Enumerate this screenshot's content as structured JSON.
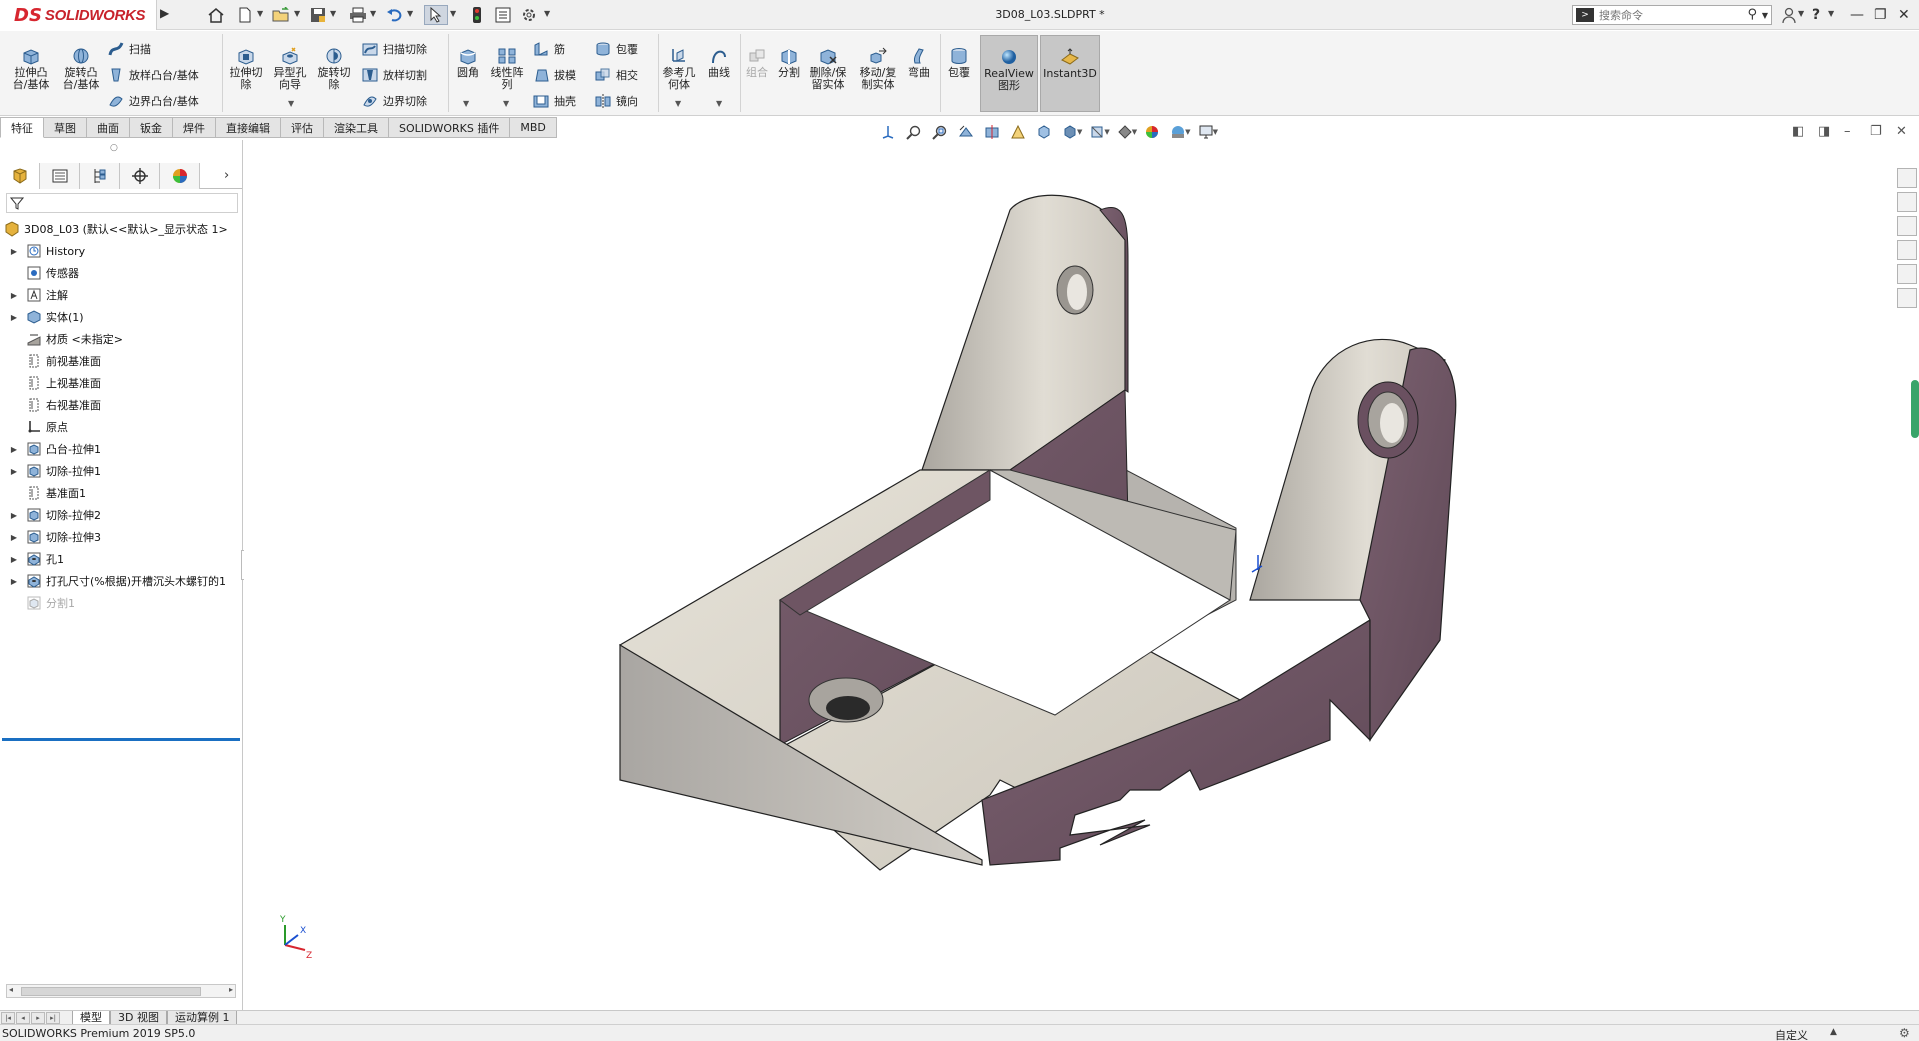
{
  "app": {
    "brand_ds": "DS",
    "brand_name": "SOLIDWORKS",
    "document_title": "3D08_L03.SLDPRT *",
    "search_placeholder": "搜索命令",
    "help": "?"
  },
  "ribbon": {
    "extrude_boss": "拉伸凸台/基体",
    "revolve_boss": "旋转凸台/基体",
    "sweep": "扫描",
    "loft_boss": "放样凸台/基体",
    "boundary_boss": "边界凸台/基体",
    "extrude_cut": "拉伸切除",
    "hole_wizard": "异型孔向导",
    "revolve_cut": "旋转切除",
    "sweep_cut": "扫描切除",
    "loft_cut": "放样切割",
    "boundary_cut": "边界切除",
    "fillet": "圆角",
    "linear_pattern": "线性阵列",
    "rib": "筋",
    "draft": "拔模",
    "shell": "抽壳",
    "wrap": "包覆",
    "intersect": "相交",
    "mirror": "镜向",
    "ref_geometry": "参考几何体",
    "curves": "曲线",
    "combine": "组合",
    "split": "分割",
    "delete_keep_body": "删除/保留实体",
    "move_copy_body": "移动/复制实体",
    "flex": "弯曲",
    "wrap2": "包覆",
    "realview": "RealView图形",
    "instant3d": "Instant3D"
  },
  "command_tabs": [
    "特征",
    "草图",
    "曲面",
    "钣金",
    "焊件",
    "直接编辑",
    "评估",
    "渲染工具",
    "SOLIDWORKS 插件",
    "MBD"
  ],
  "feature_tree": {
    "root": "3D08_L03 (默认<<默认>_显示状态 1>",
    "items": [
      {
        "label": "History",
        "expand": true,
        "icon": "history-icon"
      },
      {
        "label": "传感器",
        "expand": false,
        "icon": "sensor-icon"
      },
      {
        "label": "注解",
        "expand": true,
        "icon": "annotation-icon"
      },
      {
        "label": "实体(1)",
        "expand": true,
        "icon": "solid-body-icon"
      },
      {
        "label": "材质 <未指定>",
        "expand": false,
        "icon": "material-icon"
      },
      {
        "label": "前视基准面",
        "expand": false,
        "icon": "plane-icon"
      },
      {
        "label": "上视基准面",
        "expand": false,
        "icon": "plane-icon"
      },
      {
        "label": "右视基准面",
        "expand": false,
        "icon": "plane-icon"
      },
      {
        "label": "原点",
        "expand": false,
        "icon": "origin-icon"
      },
      {
        "label": "凸台-拉伸1",
        "expand": true,
        "icon": "extrude-icon"
      },
      {
        "label": "切除-拉伸1",
        "expand": true,
        "icon": "extrude-icon"
      },
      {
        "label": "基准面1",
        "expand": false,
        "icon": "plane-icon"
      },
      {
        "label": "切除-拉伸2",
        "expand": true,
        "icon": "extrude-icon"
      },
      {
        "label": "切除-拉伸3",
        "expand": true,
        "icon": "extrude-icon"
      },
      {
        "label": "孔1",
        "expand": true,
        "icon": "hole-icon"
      },
      {
        "label": "打孔尺寸(%根据)开槽沉头木螺钉的1",
        "expand": true,
        "icon": "hole-icon"
      },
      {
        "label": "分割1",
        "expand": false,
        "icon": "split-icon",
        "faded": true
      }
    ]
  },
  "bottom_tabs": [
    "模型",
    "3D 视图",
    "运动算例 1"
  ],
  "status": {
    "product": "SOLIDWORKS Premium 2019 SP5.0",
    "units": "自定义"
  },
  "colors": {
    "part_face_light": "#d9d5cc",
    "part_face_purple": "#6e5563",
    "part_face_grey": "#b9b6b1",
    "selection_blue": "#1a6fc2",
    "brand_red": "#d7262f"
  }
}
